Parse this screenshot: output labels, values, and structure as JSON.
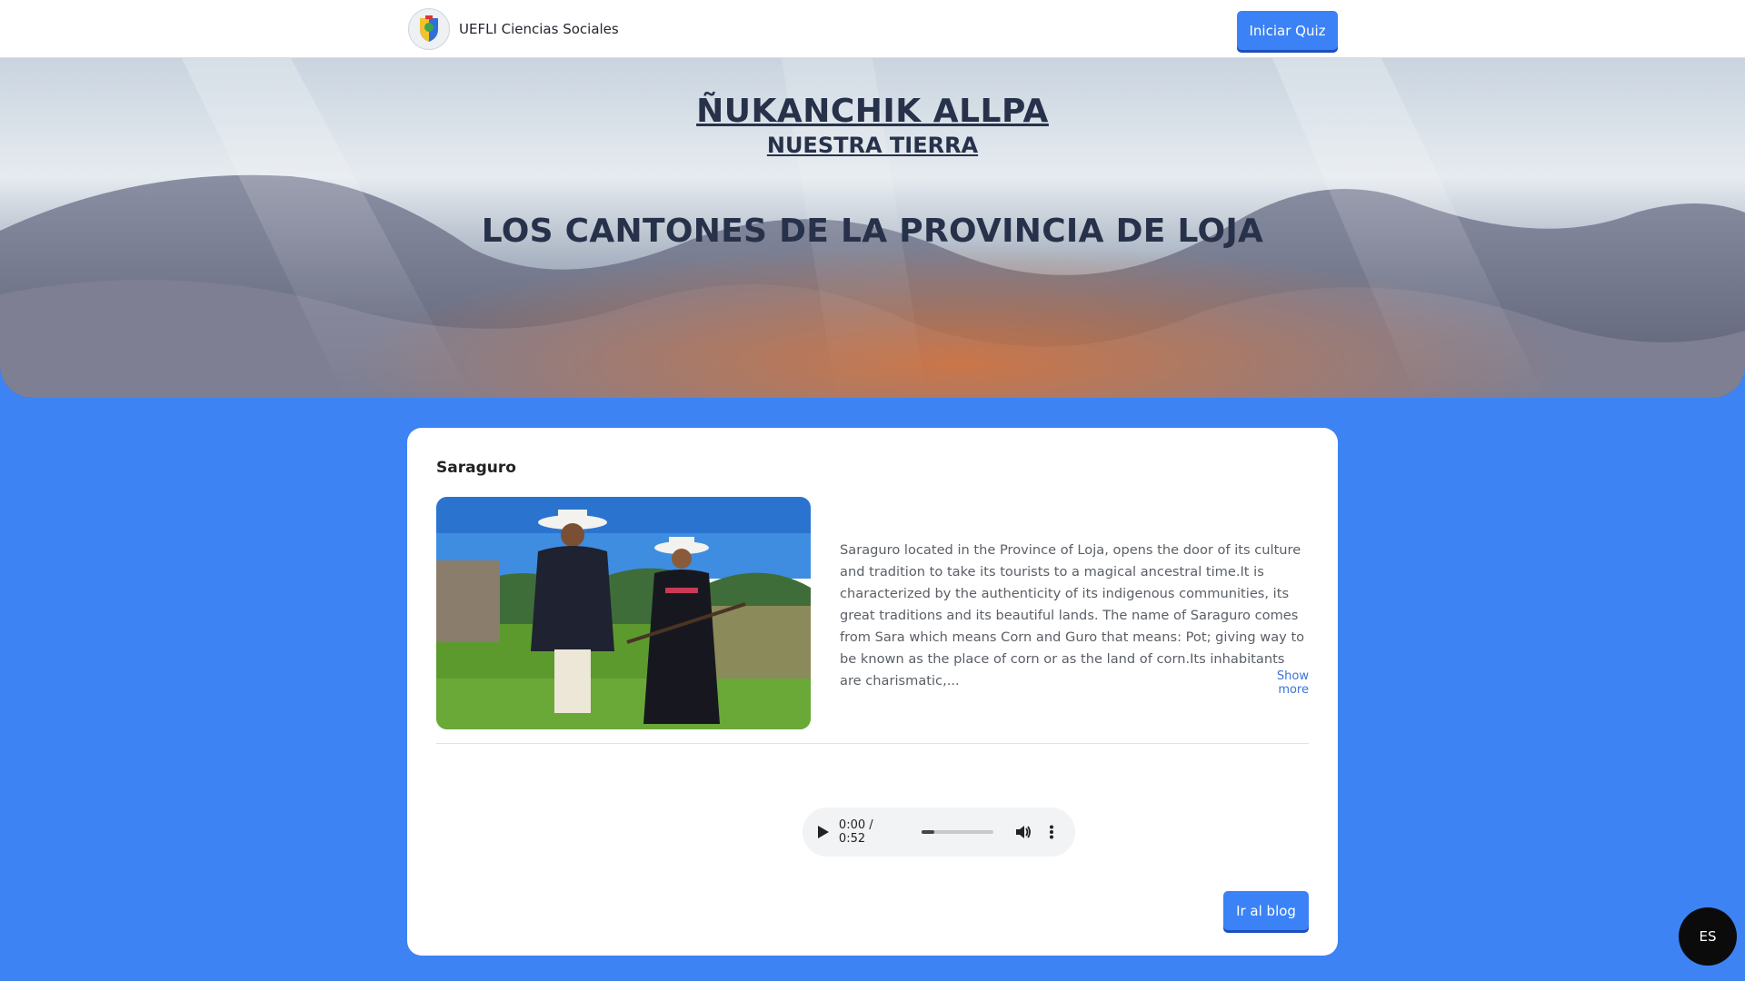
{
  "navbar": {
    "brand_name": "UEFLI Ciencias Sociales",
    "quiz_button": "Iniciar Quiz"
  },
  "hero": {
    "title": "ÑUKANCHIK ALLPA",
    "subtitle": "NUESTRA TIERRA",
    "heading": "LOS CANTONES DE LA PROVINCIA DE LOJA"
  },
  "card": {
    "title": "Saraguro",
    "description": "Saraguro located in the Province of Loja, opens the door of its culture and tradition to take its tourists to a magical ancestral time.It is characterized by the authenticity of its indigenous communities, its great traditions and its beautiful lands. The name of Saraguro comes from Sara which means Corn and Guro that means: Pot; giving way to be known as the place of corn or as the land of corn.Its inhabitants are charismatic,...",
    "show_more": "Show more",
    "audio": {
      "time": "0:00 / 0:52",
      "progress": 0.0
    },
    "blog_button": "Ir al blog"
  },
  "language_button": "ES",
  "icons": {
    "logo": "school-crest-icon",
    "play": "play-icon",
    "volume": "volume-icon",
    "more": "more-vertical-icon"
  },
  "colors": {
    "background": "#3d83f3",
    "accent": "#3b82f6",
    "title_text": "#27324a"
  }
}
